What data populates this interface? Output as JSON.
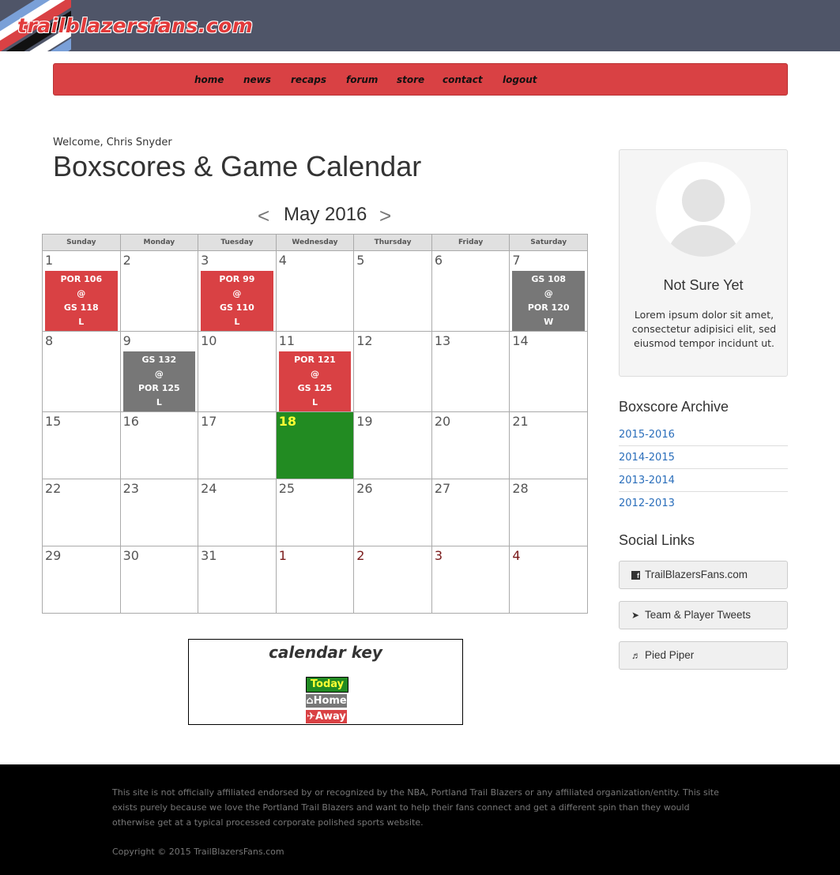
{
  "header": {
    "logo_text": "trailblazersfans.com"
  },
  "nav": {
    "items": [
      "home",
      "news",
      "recaps",
      "forum",
      "store",
      "contact",
      "logout"
    ]
  },
  "welcome": "Welcome, Chris Snyder",
  "page_title": "Boxscores & Game Calendar",
  "calendar": {
    "prev": "<",
    "next": ">",
    "month": "May 2016",
    "weekdays": [
      "Sunday",
      "Monday",
      "Tuesday",
      "Wednesday",
      "Thursday",
      "Friday",
      "Saturday"
    ],
    "days": [
      {
        "d": "1",
        "game": {
          "type": "away",
          "lines": [
            "POR 106",
            "@",
            "GS 118",
            "L"
          ]
        }
      },
      {
        "d": "2"
      },
      {
        "d": "3",
        "game": {
          "type": "away",
          "lines": [
            "POR 99",
            "@",
            "GS 110",
            "L"
          ]
        }
      },
      {
        "d": "4"
      },
      {
        "d": "5"
      },
      {
        "d": "6"
      },
      {
        "d": "7",
        "game": {
          "type": "home",
          "lines": [
            "GS 108",
            "@",
            "POR 120",
            "W"
          ]
        }
      },
      {
        "d": "8"
      },
      {
        "d": "9",
        "game": {
          "type": "home",
          "lines": [
            "GS 132",
            "@",
            "POR 125",
            "L"
          ]
        }
      },
      {
        "d": "10"
      },
      {
        "d": "11",
        "game": {
          "type": "away",
          "lines": [
            "POR 121",
            "@",
            "GS 125",
            "L"
          ]
        }
      },
      {
        "d": "12"
      },
      {
        "d": "13"
      },
      {
        "d": "14"
      },
      {
        "d": "15"
      },
      {
        "d": "16"
      },
      {
        "d": "17"
      },
      {
        "d": "18",
        "today": true
      },
      {
        "d": "19"
      },
      {
        "d": "20"
      },
      {
        "d": "21"
      },
      {
        "d": "22"
      },
      {
        "d": "23"
      },
      {
        "d": "24"
      },
      {
        "d": "25"
      },
      {
        "d": "26"
      },
      {
        "d": "27"
      },
      {
        "d": "28"
      },
      {
        "d": "29"
      },
      {
        "d": "30"
      },
      {
        "d": "31"
      },
      {
        "d": "1",
        "other": true
      },
      {
        "d": "2",
        "other": true
      },
      {
        "d": "3",
        "other": true
      },
      {
        "d": "4",
        "other": true
      }
    ]
  },
  "calendar_key": {
    "title": "calendar key",
    "today": "Today",
    "home": "Home",
    "away": "Away"
  },
  "profile": {
    "name": "Not Sure Yet",
    "description": "Lorem ipsum dolor sit amet, consectetur adipisici elit, sed eiusmod tempor incidunt ut."
  },
  "archive": {
    "heading": "Boxscore Archive",
    "links": [
      "2015-2016",
      "2014-2015",
      "2013-2014",
      "2012-2013"
    ]
  },
  "social": {
    "heading": "Social Links",
    "links": [
      {
        "label": "TrailBlazersFans.com",
        "icon": "facebook-icon"
      },
      {
        "label": "Team & Player Tweets",
        "icon": "twitter-icon"
      },
      {
        "label": "Pied Piper",
        "icon": "piper-icon"
      }
    ]
  },
  "footer": {
    "disclaimer": "This site is not officially affiliated endorsed by or recognized by the NBA, Portland Trail Blazers or any affiliated organization/entity. This site exists purely because we love the Portland Trail Blazers and want to help their fans connect and get a different spin than they would otherwise get at a typical processed corporate polished sports website.",
    "copyright": "Copyright © 2015 TrailBlazersFans.com"
  },
  "colors": {
    "header_bg": "#4f5568",
    "nav_bg": "#d94144",
    "away": "#d94144",
    "home": "#777777",
    "today": "#228b22",
    "link": "#2a6ebb"
  }
}
